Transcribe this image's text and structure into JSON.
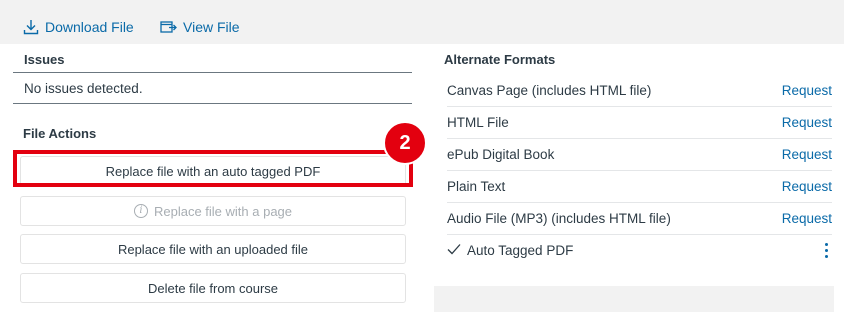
{
  "toolbar": {
    "download_label": "Download File",
    "view_label": "View File"
  },
  "issues": {
    "title": "Issues",
    "message": "No issues detected."
  },
  "file_actions": {
    "title": "File Actions",
    "buttons": [
      {
        "label": "Replace file with an auto tagged PDF",
        "enabled": true
      },
      {
        "label": "Replace file with a page",
        "enabled": false
      },
      {
        "label": "Replace file with an uploaded file",
        "enabled": true
      },
      {
        "label": "Delete file from course",
        "enabled": true
      }
    ]
  },
  "callout": {
    "number": "2",
    "color": "#e3000f"
  },
  "alternate_formats": {
    "title": "Alternate Formats",
    "request_label": "Request",
    "items": [
      {
        "label": "Canvas Page (includes HTML file)"
      },
      {
        "label": "HTML File"
      },
      {
        "label": "ePub Digital Book"
      },
      {
        "label": "Plain Text"
      },
      {
        "label": "Audio File (MP3) (includes HTML file)"
      }
    ],
    "completed": {
      "label": "Auto Tagged PDF",
      "icon": "checkmark-icon",
      "menu_icon": "kebab-menu-icon"
    }
  },
  "colors": {
    "link": "#0a6aa8",
    "text": "#2d3b45",
    "highlight": "#e3000f"
  }
}
